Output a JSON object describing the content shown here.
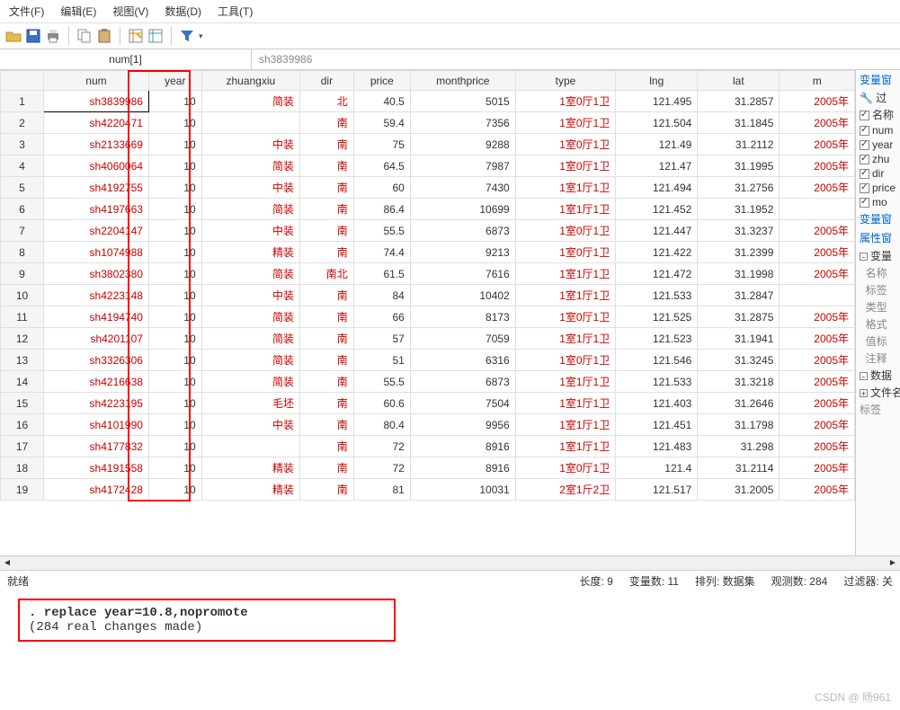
{
  "menu": {
    "file": "文件(F)",
    "edit": "编辑(E)",
    "view": "视图(V)",
    "data": "数据(D)",
    "tools": "工具(T)"
  },
  "filter": {
    "cell": "num[1]",
    "value": "sh3839986"
  },
  "columns": [
    "num",
    "year",
    "zhuangxiu",
    "dir",
    "price",
    "monthprice",
    "type",
    "lng",
    "lat",
    "m"
  ],
  "rows": [
    {
      "i": 1,
      "num": "sh3839986",
      "year": "10",
      "zhuangxiu": "简装",
      "dir": "北",
      "price": "40.5",
      "monthprice": "5015",
      "type": "1室0厅1卫",
      "lng": "121.495",
      "lat": "31.2857",
      "m": "2005年"
    },
    {
      "i": 2,
      "num": "sh4220471",
      "year": "10",
      "zhuangxiu": "",
      "dir": "南",
      "price": "59.4",
      "monthprice": "7356",
      "type": "1室0厅1卫",
      "lng": "121.504",
      "lat": "31.1845",
      "m": "2005年"
    },
    {
      "i": 3,
      "num": "sh2133669",
      "year": "10",
      "zhuangxiu": "中装",
      "dir": "南",
      "price": "75",
      "monthprice": "9288",
      "type": "1室0厅1卫",
      "lng": "121.49",
      "lat": "31.2112",
      "m": "2005年"
    },
    {
      "i": 4,
      "num": "sh4060064",
      "year": "10",
      "zhuangxiu": "简装",
      "dir": "南",
      "price": "64.5",
      "monthprice": "7987",
      "type": "1室0厅1卫",
      "lng": "121.47",
      "lat": "31.1995",
      "m": "2005年"
    },
    {
      "i": 5,
      "num": "sh4192755",
      "year": "10",
      "zhuangxiu": "中装",
      "dir": "南",
      "price": "60",
      "monthprice": "7430",
      "type": "1室1厅1卫",
      "lng": "121.494",
      "lat": "31.2756",
      "m": "2005年"
    },
    {
      "i": 6,
      "num": "sh4197663",
      "year": "10",
      "zhuangxiu": "简装",
      "dir": "南",
      "price": "86.4",
      "monthprice": "10699",
      "type": "1室1厅1卫",
      "lng": "121.452",
      "lat": "31.1952",
      "m": ""
    },
    {
      "i": 7,
      "num": "sh2204147",
      "year": "10",
      "zhuangxiu": "中装",
      "dir": "南",
      "price": "55.5",
      "monthprice": "6873",
      "type": "1室0厅1卫",
      "lng": "121.447",
      "lat": "31.3237",
      "m": "2005年"
    },
    {
      "i": 8,
      "num": "sh1074988",
      "year": "10",
      "zhuangxiu": "精装",
      "dir": "南",
      "price": "74.4",
      "monthprice": "9213",
      "type": "1室0厅1卫",
      "lng": "121.422",
      "lat": "31.2399",
      "m": "2005年"
    },
    {
      "i": 9,
      "num": "sh3802380",
      "year": "10",
      "zhuangxiu": "简装",
      "dir": "南北",
      "price": "61.5",
      "monthprice": "7616",
      "type": "1室1厅1卫",
      "lng": "121.472",
      "lat": "31.1998",
      "m": "2005年"
    },
    {
      "i": 10,
      "num": "sh4223148",
      "year": "10",
      "zhuangxiu": "中装",
      "dir": "南",
      "price": "84",
      "monthprice": "10402",
      "type": "1室1厅1卫",
      "lng": "121.533",
      "lat": "31.2847",
      "m": ""
    },
    {
      "i": 11,
      "num": "sh4194740",
      "year": "10",
      "zhuangxiu": "简装",
      "dir": "南",
      "price": "66",
      "monthprice": "8173",
      "type": "1室0厅1卫",
      "lng": "121.525",
      "lat": "31.2875",
      "m": "2005年"
    },
    {
      "i": 12,
      "num": "sh4201107",
      "year": "10",
      "zhuangxiu": "简装",
      "dir": "南",
      "price": "57",
      "monthprice": "7059",
      "type": "1室1厅1卫",
      "lng": "121.523",
      "lat": "31.1941",
      "m": "2005年"
    },
    {
      "i": 13,
      "num": "sh3326306",
      "year": "10",
      "zhuangxiu": "简装",
      "dir": "南",
      "price": "51",
      "monthprice": "6316",
      "type": "1室0厅1卫",
      "lng": "121.546",
      "lat": "31.3245",
      "m": "2005年"
    },
    {
      "i": 14,
      "num": "sh4216638",
      "year": "10",
      "zhuangxiu": "简装",
      "dir": "南",
      "price": "55.5",
      "monthprice": "6873",
      "type": "1室1厅1卫",
      "lng": "121.533",
      "lat": "31.3218",
      "m": "2005年"
    },
    {
      "i": 15,
      "num": "sh4223195",
      "year": "10",
      "zhuangxiu": "毛坯",
      "dir": "南",
      "price": "60.6",
      "monthprice": "7504",
      "type": "1室1厅1卫",
      "lng": "121.403",
      "lat": "31.2646",
      "m": "2005年"
    },
    {
      "i": 16,
      "num": "sh4101990",
      "year": "10",
      "zhuangxiu": "中装",
      "dir": "南",
      "price": "80.4",
      "monthprice": "9956",
      "type": "1室1厅1卫",
      "lng": "121.451",
      "lat": "31.1798",
      "m": "2005年"
    },
    {
      "i": 17,
      "num": "sh4177832",
      "year": "10",
      "zhuangxiu": "",
      "dir": "南",
      "price": "72",
      "monthprice": "8916",
      "type": "1室1厅1卫",
      "lng": "121.483",
      "lat": "31.298",
      "m": "2005年"
    },
    {
      "i": 18,
      "num": "sh4191558",
      "year": "10",
      "zhuangxiu": "精装",
      "dir": "南",
      "price": "72",
      "monthprice": "8916",
      "type": "1室0厅1卫",
      "lng": "121.4",
      "lat": "31.2114",
      "m": "2005年"
    },
    {
      "i": 19,
      "num": "sh4172428",
      "year": "10",
      "zhuangxiu": "精装",
      "dir": "南",
      "price": "81",
      "monthprice": "10031",
      "type": "2室1斤2卫",
      "lng": "121.517",
      "lat": "31.2005",
      "m": "2005年"
    }
  ],
  "right": {
    "title": "变量窗",
    "filter_lbl": "过",
    "vars": [
      "名称",
      "num",
      "year",
      "zhu",
      "dir",
      "price",
      "mo"
    ],
    "var_hdr": "变量窗",
    "attr_hdr": "属性窗",
    "var_node": "变量",
    "var_items": [
      "名称",
      "标签",
      "类型",
      "格式",
      "值标",
      "注释"
    ],
    "data_node": "数据",
    "file_lbl": "文件名",
    "tag_lbl": "标签"
  },
  "status": {
    "ready": "就绪",
    "length": "长度: 9",
    "vars": "变量数: 11",
    "order": "排列: 数据集",
    "obs": "观测数: 284",
    "filter": "过滤器: 关"
  },
  "console": {
    "cmd": ". replace year=10.8,nopromote",
    "out": "(284 real changes made)"
  },
  "watermark": "CSDN @ 旸961"
}
